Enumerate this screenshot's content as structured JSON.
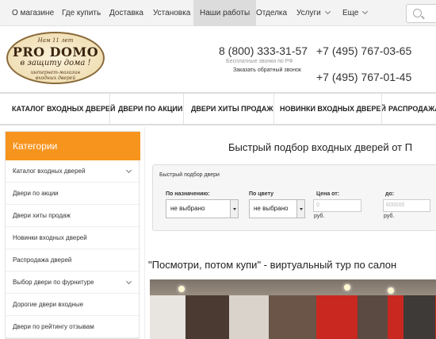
{
  "topnav": {
    "items": [
      "О магазине",
      "Где купить",
      "Доставка",
      "Установка",
      "Наши работы",
      "Отделка",
      "Услуги",
      "Еще"
    ],
    "active": "Наши работы"
  },
  "logo": {
    "line1": "Нам 11 лет",
    "line2": "PRO DOMO",
    "line3": "в защиту дома !",
    "line4a": "интернет-магазин",
    "line4b": "входных дверей"
  },
  "contacts": {
    "main_phone": "8 (800) 333-31-57",
    "main_note": "Бесплатные звонки по РФ",
    "callback": "Заказать обратный звонок",
    "phone_2": "+7 (495) 767-03-65",
    "phone_3": "+7 (495) 767-01-45"
  },
  "catnav": [
    "КАТАЛОГ ВХОДНЫХ ДВЕРЕЙ",
    "ДВЕРИ ПО АКЦИИ",
    "ДВЕРИ ХИТЫ ПРОДАЖ",
    "НОВИНКИ ВХОДНЫХ ДВЕРЕЙ",
    "РАСПРОДАЖА"
  ],
  "sidebar": {
    "title": "Категории",
    "items": [
      "Каталог входных дверей",
      "Двери по акции",
      "Двери хиты продаж",
      "Новинки входных дверей",
      "Распродажа дверей",
      "Выбор двери по фурнитуре",
      "Дорогие двери входные",
      "Двери по рейтингу отзывам"
    ]
  },
  "content": {
    "title": "Быстрый подбор входных дверей от П",
    "filter": {
      "legend": "Быстрый подбор двери",
      "purpose_label": "По назначению:",
      "purpose_value": "не выбрано",
      "color_label": "По цвету",
      "color_value": "не выбрано",
      "price_from_label": "Цена от:",
      "price_from_placeholder": "0",
      "price_to_label": "до:",
      "price_to_placeholder": "600000",
      "currency": "руб."
    },
    "tour_title": "\"Посмотри, потом купи\" - виртуальный тур по салон"
  },
  "colors": {
    "accent": "#f7941d",
    "topnav_bg": "#f3f3f3",
    "active_bg": "#dcdcdc"
  }
}
